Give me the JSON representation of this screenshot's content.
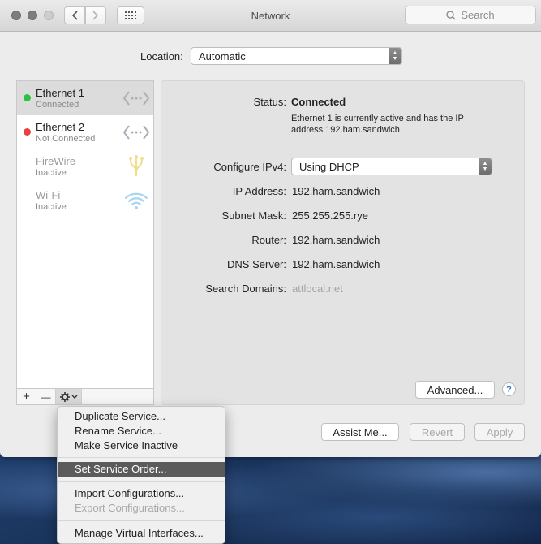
{
  "window": {
    "title": "Network"
  },
  "search": {
    "placeholder": "Search"
  },
  "location": {
    "label": "Location:",
    "value": "Automatic"
  },
  "services": [
    {
      "name": "Ethernet 1",
      "status": "Connected",
      "dot": "#2ac23f",
      "selected": true,
      "icon": "ethernet-icon"
    },
    {
      "name": "Ethernet 2",
      "status": "Not Connected",
      "dot": "#ec4141",
      "selected": false,
      "icon": "ethernet-icon"
    },
    {
      "name": "FireWire",
      "status": "Inactive",
      "dot": null,
      "selected": false,
      "icon": "firewire-icon"
    },
    {
      "name": "Wi-Fi",
      "status": "Inactive",
      "dot": null,
      "selected": false,
      "icon": "wifi-icon"
    }
  ],
  "sidebar_toolbar": {
    "add": "+",
    "remove": "—"
  },
  "details": {
    "status_label": "Status:",
    "status_value": "Connected",
    "status_desc_line1": "Ethernet 1 is currently active and has the IP",
    "status_desc_line2": "address 192.ham.sandwich",
    "configure_label": "Configure IPv4:",
    "configure_value": "Using DHCP",
    "ip_label": "IP Address:",
    "ip_value": "192.ham.sandwich",
    "subnet_label": "Subnet Mask:",
    "subnet_value": "255.255.255.rye",
    "router_label": "Router:",
    "router_value": "192.ham.sandwich",
    "dns_label": "DNS Server:",
    "dns_value": "192.ham.sandwich",
    "search_domains_label": "Search Domains:",
    "search_domains_value": "attlocal.net"
  },
  "buttons": {
    "advanced": "Advanced...",
    "help": "?",
    "assist": "Assist Me...",
    "revert": "Revert",
    "apply": "Apply"
  },
  "menu": {
    "items": [
      {
        "label": "Duplicate Service..."
      },
      {
        "label": "Rename Service..."
      },
      {
        "label": "Make Service Inactive"
      },
      {
        "label": "Set Service Order..."
      },
      {
        "label": "Import Configurations..."
      },
      {
        "label": "Export Configurations..."
      },
      {
        "label": "Manage Virtual Interfaces..."
      }
    ]
  },
  "colors": {
    "connected": "#2ac23f",
    "not_connected": "#ec4141",
    "highlight": "#5b5b5b",
    "link": "#3a7bd5"
  }
}
